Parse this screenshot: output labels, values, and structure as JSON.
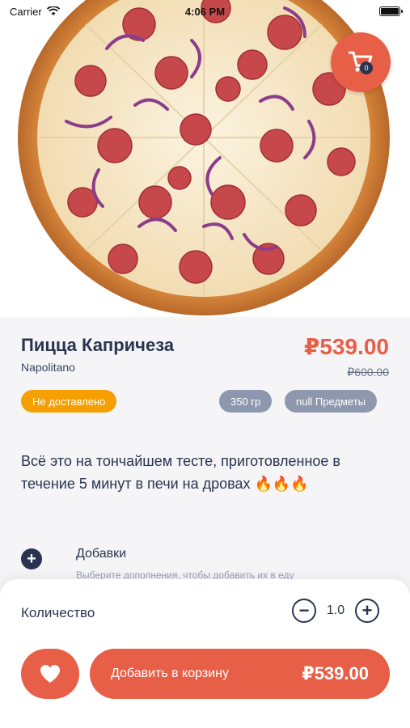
{
  "status_bar": {
    "carrier": "Carrier",
    "time": "4:06 PM"
  },
  "cart": {
    "count": "0"
  },
  "product": {
    "title": "Пицца Капричеза",
    "subtitle": "Napolitano",
    "price": "₽539.00",
    "old_price": "₽600.00",
    "delivery_badge": "Не доставлено",
    "weight_badge": "350 гр",
    "items_badge": "null Предметы",
    "description": "Всё это на тончайшем тесте, приготовленное в течение 5 минут в печи на дровах 🔥🔥🔥"
  },
  "addons": {
    "title": "Добавки",
    "hint": "Выберите дополнения, чтобы добавить их в еду"
  },
  "quantity": {
    "label": "Количество",
    "value": "1.0",
    "minus": "−",
    "plus": "+"
  },
  "footer": {
    "add_label": "Добавить в корзину",
    "add_price": "₽539.00"
  },
  "colors": {
    "accent": "#e85f47",
    "navy": "#2a3450",
    "delivery": "#f5a000",
    "chip": "#8d97ad"
  }
}
